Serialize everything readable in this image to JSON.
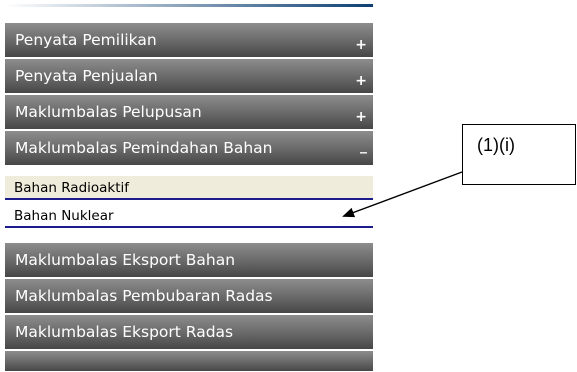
{
  "menu": {
    "items": [
      {
        "label": "Penyata Pemilikan",
        "toggle": "+"
      },
      {
        "label": "Penyata Penjualan",
        "toggle": "+"
      },
      {
        "label": "Maklumbalas Pelupusan",
        "toggle": "+"
      },
      {
        "label": "Maklumbalas Pemindahan Bahan",
        "toggle": "_"
      }
    ],
    "sub_items": [
      {
        "label": "Bahan Radioaktif",
        "state": "highlighted"
      },
      {
        "label": "Bahan Nuklear",
        "state": "normal"
      }
    ],
    "items_after": [
      {
        "label": "Maklumbalas Eksport Bahan"
      },
      {
        "label": "Maklumbalas Pembubaran Radas"
      },
      {
        "label": "Maklumbalas Eksport Radas"
      }
    ]
  },
  "callout": {
    "text": "(1)(i)"
  },
  "colors": {
    "menu_bar_top": "#8d8d8d",
    "menu_bar_bottom": "#474747",
    "sub_item_highlight": "#f0ecdb",
    "sub_item_border": "#1b1b8c",
    "top_rule": "#0d3f72"
  }
}
